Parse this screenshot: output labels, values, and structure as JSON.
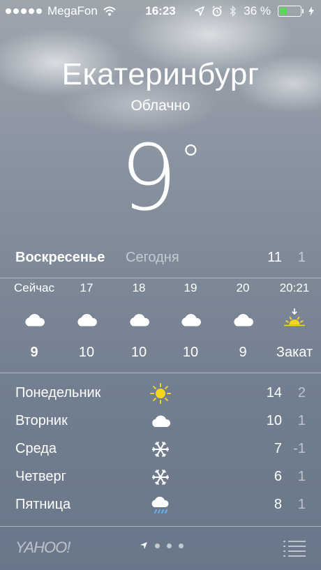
{
  "status_bar": {
    "carrier": "MegaFon",
    "time": "16:23",
    "battery": "36 %",
    "battery_level": 0.36,
    "battery_color": "#5cd75c"
  },
  "header": {
    "city": "Екатеринбург",
    "condition": "Облачно",
    "temperature": "9",
    "degree_symbol": "°"
  },
  "today": {
    "day": "Воскресенье",
    "relative": "Сегодня",
    "high": "11",
    "low": "1"
  },
  "hourly": [
    {
      "time": "Сейчас",
      "icon": "cloud-icon",
      "value": "9",
      "bold": true
    },
    {
      "time": "17",
      "icon": "cloud-icon",
      "value": "10"
    },
    {
      "time": "18",
      "icon": "cloud-icon",
      "value": "10"
    },
    {
      "time": "19",
      "icon": "cloud-icon",
      "value": "10"
    },
    {
      "time": "20",
      "icon": "cloud-icon",
      "value": "9"
    },
    {
      "time": "20:21",
      "icon": "sunset-icon",
      "value": "Закат"
    }
  ],
  "daily": [
    {
      "day": "Понедельник",
      "icon": "sun-icon",
      "high": "14",
      "low": "2"
    },
    {
      "day": "Вторник",
      "icon": "cloud-icon",
      "high": "10",
      "low": "1"
    },
    {
      "day": "Среда",
      "icon": "snowflake-icon",
      "high": "7",
      "low": "-1"
    },
    {
      "day": "Четверг",
      "icon": "snowflake-icon",
      "high": "6",
      "low": "1"
    },
    {
      "day": "Пятница",
      "icon": "cloud-rain-icon",
      "high": "8",
      "low": "1"
    }
  ],
  "bottom_bar": {
    "logo": "YAHOO!",
    "page_count": 3
  },
  "colors": {
    "sun": "#f5d61e",
    "rain": "#62b6f0"
  }
}
